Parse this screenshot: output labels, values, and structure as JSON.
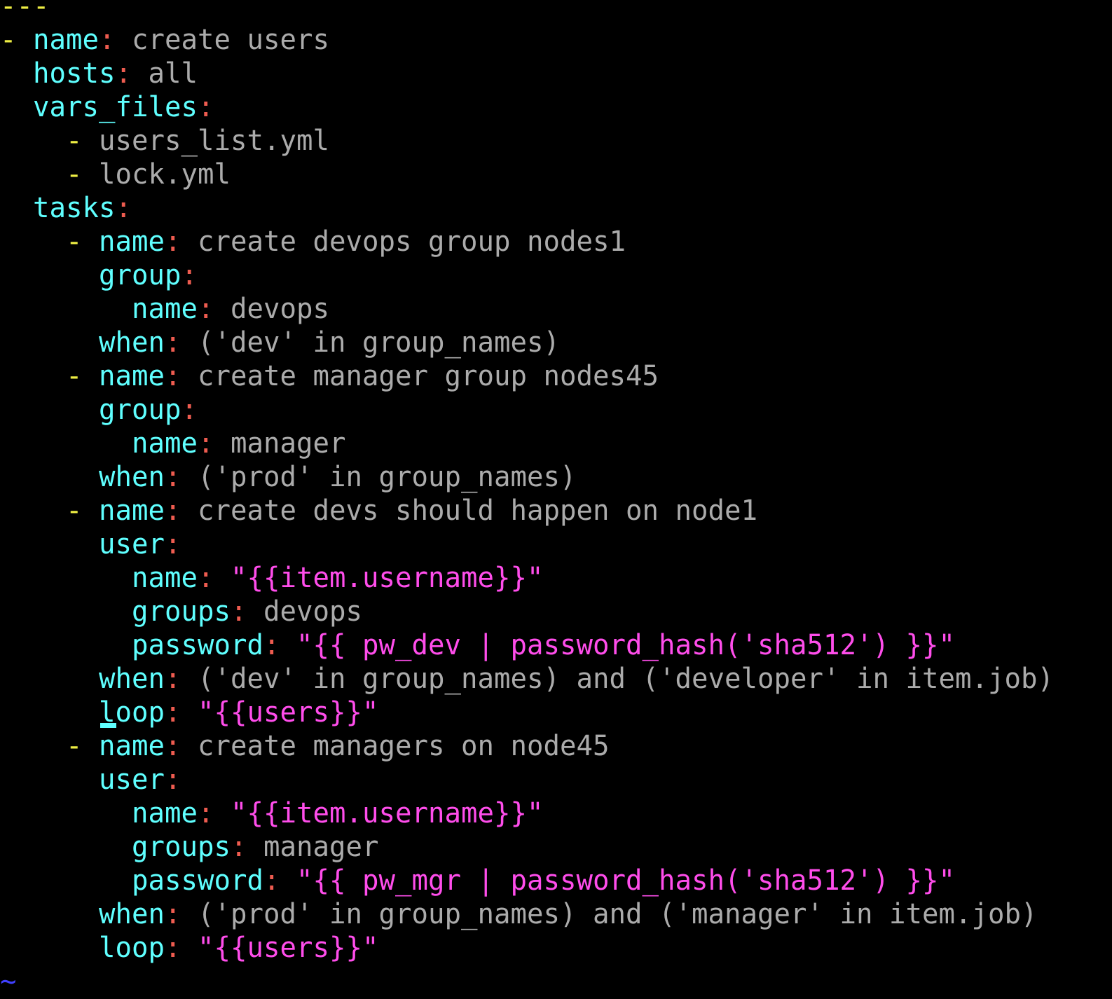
{
  "app": {
    "name": "vim",
    "mode": "normal",
    "filetype": "yaml"
  },
  "theme": {
    "background": "#000000",
    "doc_marker": "#4040FF",
    "key": "#5FFFFF",
    "punctuation": "#EE5C50",
    "list_dash": "#EEEE44",
    "scalar": "#ABABAB",
    "string": "#FF4DEB",
    "tilde": "#4040FF",
    "cursor": "#5FFFFF"
  },
  "cursor": {
    "line": 21,
    "column": 6
  },
  "document": {
    "doc_start": "---",
    "lines": [
      {
        "id": "line-1",
        "tokens": [
          {
            "cls": "t-dash",
            "text": "---"
          }
        ]
      },
      {
        "id": "line-2",
        "tokens": [
          {
            "cls": "t-dash",
            "text": "- "
          },
          {
            "cls": "t-key",
            "text": "name"
          },
          {
            "cls": "t-colon",
            "text": ":"
          },
          {
            "cls": "t-val",
            "text": " create users"
          }
        ]
      },
      {
        "id": "line-3",
        "tokens": [
          {
            "cls": "t-val",
            "text": "  "
          },
          {
            "cls": "t-key",
            "text": "hosts"
          },
          {
            "cls": "t-colon",
            "text": ":"
          },
          {
            "cls": "t-val",
            "text": " all"
          }
        ]
      },
      {
        "id": "line-4",
        "tokens": [
          {
            "cls": "t-val",
            "text": "  "
          },
          {
            "cls": "t-key",
            "text": "vars_files"
          },
          {
            "cls": "t-colon",
            "text": ":"
          }
        ]
      },
      {
        "id": "line-5",
        "tokens": [
          {
            "cls": "t-val",
            "text": "    "
          },
          {
            "cls": "t-dash",
            "text": "-"
          },
          {
            "cls": "t-val",
            "text": " users_list.yml"
          }
        ]
      },
      {
        "id": "line-6",
        "tokens": [
          {
            "cls": "t-val",
            "text": "    "
          },
          {
            "cls": "t-dash",
            "text": "-"
          },
          {
            "cls": "t-val",
            "text": " lock.yml"
          }
        ]
      },
      {
        "id": "line-7",
        "tokens": [
          {
            "cls": "t-val",
            "text": "  "
          },
          {
            "cls": "t-key",
            "text": "tasks"
          },
          {
            "cls": "t-colon",
            "text": ":"
          }
        ]
      },
      {
        "id": "line-8",
        "tokens": [
          {
            "cls": "t-val",
            "text": "    "
          },
          {
            "cls": "t-dash",
            "text": "- "
          },
          {
            "cls": "t-key",
            "text": "name"
          },
          {
            "cls": "t-colon",
            "text": ":"
          },
          {
            "cls": "t-val",
            "text": " create devops group nodes1"
          }
        ]
      },
      {
        "id": "line-9",
        "tokens": [
          {
            "cls": "t-val",
            "text": "      "
          },
          {
            "cls": "t-key",
            "text": "group"
          },
          {
            "cls": "t-colon",
            "text": ":"
          }
        ]
      },
      {
        "id": "line-10",
        "tokens": [
          {
            "cls": "t-val",
            "text": "        "
          },
          {
            "cls": "t-key",
            "text": "name"
          },
          {
            "cls": "t-colon",
            "text": ":"
          },
          {
            "cls": "t-val",
            "text": " devops"
          }
        ]
      },
      {
        "id": "line-11",
        "tokens": [
          {
            "cls": "t-val",
            "text": "      "
          },
          {
            "cls": "t-key",
            "text": "when"
          },
          {
            "cls": "t-colon",
            "text": ":"
          },
          {
            "cls": "t-val",
            "text": " ('dev' in group_names)"
          }
        ]
      },
      {
        "id": "line-12",
        "tokens": [
          {
            "cls": "t-val",
            "text": "    "
          },
          {
            "cls": "t-dash",
            "text": "- "
          },
          {
            "cls": "t-key",
            "text": "name"
          },
          {
            "cls": "t-colon",
            "text": ":"
          },
          {
            "cls": "t-val",
            "text": " create manager group nodes45"
          }
        ]
      },
      {
        "id": "line-13",
        "tokens": [
          {
            "cls": "t-val",
            "text": "      "
          },
          {
            "cls": "t-key",
            "text": "group"
          },
          {
            "cls": "t-colon",
            "text": ":"
          }
        ]
      },
      {
        "id": "line-14",
        "tokens": [
          {
            "cls": "t-val",
            "text": "        "
          },
          {
            "cls": "t-key",
            "text": "name"
          },
          {
            "cls": "t-colon",
            "text": ":"
          },
          {
            "cls": "t-val",
            "text": " manager"
          }
        ]
      },
      {
        "id": "line-15",
        "tokens": [
          {
            "cls": "t-val",
            "text": "      "
          },
          {
            "cls": "t-key",
            "text": "when"
          },
          {
            "cls": "t-colon",
            "text": ":"
          },
          {
            "cls": "t-val",
            "text": " ('prod' in group_names)"
          }
        ]
      },
      {
        "id": "line-16",
        "tokens": [
          {
            "cls": "t-val",
            "text": "    "
          },
          {
            "cls": "t-dash",
            "text": "- "
          },
          {
            "cls": "t-key",
            "text": "name"
          },
          {
            "cls": "t-colon",
            "text": ":"
          },
          {
            "cls": "t-val",
            "text": " create devs should happen on node1"
          }
        ]
      },
      {
        "id": "line-17",
        "tokens": [
          {
            "cls": "t-val",
            "text": "      "
          },
          {
            "cls": "t-key",
            "text": "user"
          },
          {
            "cls": "t-colon",
            "text": ":"
          }
        ]
      },
      {
        "id": "line-18",
        "tokens": [
          {
            "cls": "t-val",
            "text": "        "
          },
          {
            "cls": "t-key",
            "text": "name"
          },
          {
            "cls": "t-colon",
            "text": ":"
          },
          {
            "cls": "t-val",
            "text": " "
          },
          {
            "cls": "t-str",
            "text": "\"{{item.username}}\""
          }
        ]
      },
      {
        "id": "line-19",
        "tokens": [
          {
            "cls": "t-val",
            "text": "        "
          },
          {
            "cls": "t-key",
            "text": "groups"
          },
          {
            "cls": "t-colon",
            "text": ":"
          },
          {
            "cls": "t-val",
            "text": " devops"
          }
        ]
      },
      {
        "id": "line-20",
        "tokens": [
          {
            "cls": "t-val",
            "text": "        "
          },
          {
            "cls": "t-key",
            "text": "password"
          },
          {
            "cls": "t-colon",
            "text": ":"
          },
          {
            "cls": "t-val",
            "text": " "
          },
          {
            "cls": "t-str",
            "text": "\"{{ pw_dev | password_hash('sha512') }}\""
          }
        ]
      },
      {
        "id": "line-21",
        "tokens": [
          {
            "cls": "t-val",
            "text": "      "
          },
          {
            "cls": "t-key",
            "text": "when"
          },
          {
            "cls": "t-colon",
            "text": ":"
          },
          {
            "cls": "t-val",
            "text": " ('dev' in group_names) and ('developer' in item.job)"
          }
        ]
      },
      {
        "id": "line-22",
        "tokens": [
          {
            "cls": "t-val",
            "text": "      "
          },
          {
            "cls": "t-key",
            "text": "loop"
          },
          {
            "cls": "t-colon",
            "text": ":"
          },
          {
            "cls": "t-val",
            "text": " "
          },
          {
            "cls": "t-str",
            "text": "\"{{users}}\""
          }
        ]
      },
      {
        "id": "line-23",
        "tokens": [
          {
            "cls": "t-val",
            "text": "    "
          },
          {
            "cls": "t-dash",
            "text": "- "
          },
          {
            "cls": "t-key",
            "text": "name"
          },
          {
            "cls": "t-colon",
            "text": ":"
          },
          {
            "cls": "t-val",
            "text": " create managers on node45"
          }
        ]
      },
      {
        "id": "line-24",
        "tokens": [
          {
            "cls": "t-val",
            "text": "      "
          },
          {
            "cls": "t-key",
            "text": "user"
          },
          {
            "cls": "t-colon",
            "text": ":"
          }
        ]
      },
      {
        "id": "line-25",
        "tokens": [
          {
            "cls": "t-val",
            "text": "        "
          },
          {
            "cls": "t-key",
            "text": "name"
          },
          {
            "cls": "t-colon",
            "text": ":"
          },
          {
            "cls": "t-val",
            "text": " "
          },
          {
            "cls": "t-str",
            "text": "\"{{item.username}}\""
          }
        ]
      },
      {
        "id": "line-26",
        "tokens": [
          {
            "cls": "t-val",
            "text": "        "
          },
          {
            "cls": "t-key",
            "text": "groups"
          },
          {
            "cls": "t-colon",
            "text": ":"
          },
          {
            "cls": "t-val",
            "text": " manager"
          }
        ]
      },
      {
        "id": "line-27",
        "tokens": [
          {
            "cls": "t-val",
            "text": "        "
          },
          {
            "cls": "t-key",
            "text": "password"
          },
          {
            "cls": "t-colon",
            "text": ":"
          },
          {
            "cls": "t-val",
            "text": " "
          },
          {
            "cls": "t-str",
            "text": "\"{{ pw_mgr | password_hash('sha512') }}\""
          }
        ]
      },
      {
        "id": "line-28",
        "tokens": [
          {
            "cls": "t-val",
            "text": "      "
          },
          {
            "cls": "t-key",
            "text": "when"
          },
          {
            "cls": "t-colon",
            "text": ":"
          },
          {
            "cls": "t-val",
            "text": " ('prod' in group_names) and ('manager' in item.job)"
          }
        ]
      },
      {
        "id": "line-29",
        "tokens": [
          {
            "cls": "t-val",
            "text": "      "
          },
          {
            "cls": "t-key",
            "text": "loop"
          },
          {
            "cls": "t-colon",
            "text": ":"
          },
          {
            "cls": "t-val",
            "text": " "
          },
          {
            "cls": "t-str",
            "text": "\"{{users}}\""
          }
        ]
      },
      {
        "id": "line-30",
        "tokens": [
          {
            "cls": "t-tilde",
            "text": "~"
          }
        ]
      }
    ]
  }
}
